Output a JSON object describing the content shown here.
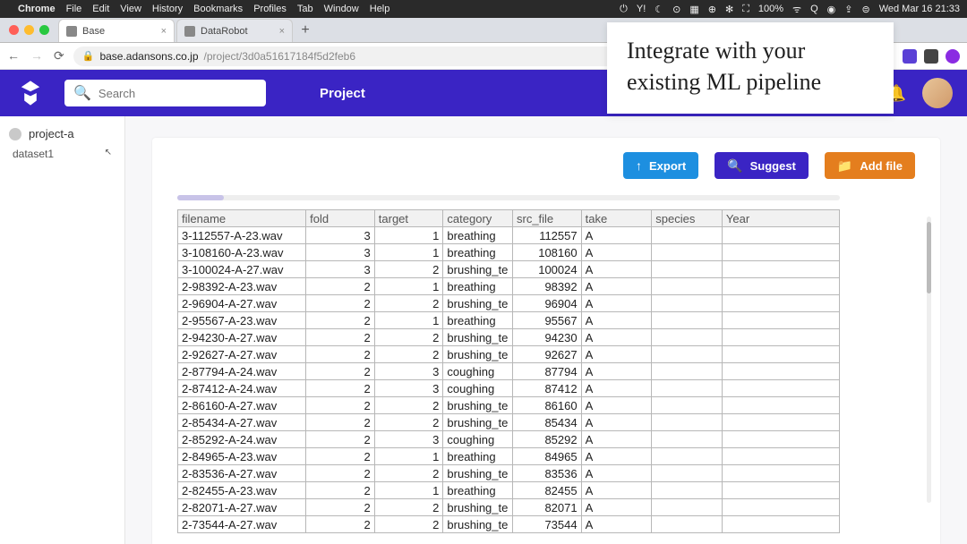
{
  "menubar": {
    "app": "Chrome",
    "items": [
      "File",
      "Edit",
      "View",
      "History",
      "Bookmarks",
      "Profiles",
      "Tab",
      "Window",
      "Help"
    ],
    "right": [
      "⏻",
      "⍂",
      "Y!",
      "☾",
      "⊙",
      "▦",
      "⊕",
      "✻",
      "⛶",
      "100%",
      "⚡",
      "≙",
      "Q",
      "◉",
      "⇪",
      "⊜"
    ],
    "clock": "Wed Mar 16  21:33"
  },
  "tabs": [
    {
      "title": "Base",
      "active": true
    },
    {
      "title": "DataRobot",
      "active": false
    }
  ],
  "url": {
    "host": "base.adansons.co.jp",
    "path": "/project/3d0a51617184f5d2feb6"
  },
  "annotation": {
    "line1": "Integrate with your",
    "line2": "existing ML pipeline"
  },
  "header": {
    "search_placeholder": "Search",
    "nav": "Project"
  },
  "sidebar": {
    "project": "project-a",
    "dataset": "dataset1"
  },
  "buttons": {
    "export": "Export",
    "suggest": "Suggest",
    "add_file": "Add file"
  },
  "table": {
    "columns": [
      "filename",
      "fold",
      "target",
      "category",
      "src_file",
      "take",
      "species",
      "Year"
    ],
    "rows": [
      {
        "filename": "3-112557-A-23.wav",
        "fold": 3,
        "target": 1,
        "category": "breathing",
        "src_file": 112557,
        "take": "A",
        "species": "",
        "Year": ""
      },
      {
        "filename": "3-108160-A-23.wav",
        "fold": 3,
        "target": 1,
        "category": "breathing",
        "src_file": 108160,
        "take": "A",
        "species": "",
        "Year": ""
      },
      {
        "filename": "3-100024-A-27.wav",
        "fold": 3,
        "target": 2,
        "category": "brushing_te",
        "src_file": 100024,
        "take": "A",
        "species": "",
        "Year": ""
      },
      {
        "filename": "2-98392-A-23.wav",
        "fold": 2,
        "target": 1,
        "category": "breathing",
        "src_file": 98392,
        "take": "A",
        "species": "",
        "Year": ""
      },
      {
        "filename": "2-96904-A-27.wav",
        "fold": 2,
        "target": 2,
        "category": "brushing_te",
        "src_file": 96904,
        "take": "A",
        "species": "",
        "Year": ""
      },
      {
        "filename": "2-95567-A-23.wav",
        "fold": 2,
        "target": 1,
        "category": "breathing",
        "src_file": 95567,
        "take": "A",
        "species": "",
        "Year": ""
      },
      {
        "filename": "2-94230-A-27.wav",
        "fold": 2,
        "target": 2,
        "category": "brushing_te",
        "src_file": 94230,
        "take": "A",
        "species": "",
        "Year": ""
      },
      {
        "filename": "2-92627-A-27.wav",
        "fold": 2,
        "target": 2,
        "category": "brushing_te",
        "src_file": 92627,
        "take": "A",
        "species": "",
        "Year": ""
      },
      {
        "filename": "2-87794-A-24.wav",
        "fold": 2,
        "target": 3,
        "category": "coughing",
        "src_file": 87794,
        "take": "A",
        "species": "",
        "Year": ""
      },
      {
        "filename": "2-87412-A-24.wav",
        "fold": 2,
        "target": 3,
        "category": "coughing",
        "src_file": 87412,
        "take": "A",
        "species": "",
        "Year": ""
      },
      {
        "filename": "2-86160-A-27.wav",
        "fold": 2,
        "target": 2,
        "category": "brushing_te",
        "src_file": 86160,
        "take": "A",
        "species": "",
        "Year": ""
      },
      {
        "filename": "2-85434-A-27.wav",
        "fold": 2,
        "target": 2,
        "category": "brushing_te",
        "src_file": 85434,
        "take": "A",
        "species": "",
        "Year": ""
      },
      {
        "filename": "2-85292-A-24.wav",
        "fold": 2,
        "target": 3,
        "category": "coughing",
        "src_file": 85292,
        "take": "A",
        "species": "",
        "Year": ""
      },
      {
        "filename": "2-84965-A-23.wav",
        "fold": 2,
        "target": 1,
        "category": "breathing",
        "src_file": 84965,
        "take": "A",
        "species": "",
        "Year": ""
      },
      {
        "filename": "2-83536-A-27.wav",
        "fold": 2,
        "target": 2,
        "category": "brushing_te",
        "src_file": 83536,
        "take": "A",
        "species": "",
        "Year": ""
      },
      {
        "filename": "2-82455-A-23.wav",
        "fold": 2,
        "target": 1,
        "category": "breathing",
        "src_file": 82455,
        "take": "A",
        "species": "",
        "Year": ""
      },
      {
        "filename": "2-82071-A-27.wav",
        "fold": 2,
        "target": 2,
        "category": "brushing_te",
        "src_file": 82071,
        "take": "A",
        "species": "",
        "Year": ""
      },
      {
        "filename": "2-73544-A-27.wav",
        "fold": 2,
        "target": 2,
        "category": "brushing_te",
        "src_file": 73544,
        "take": "A",
        "species": "",
        "Year": ""
      }
    ]
  }
}
